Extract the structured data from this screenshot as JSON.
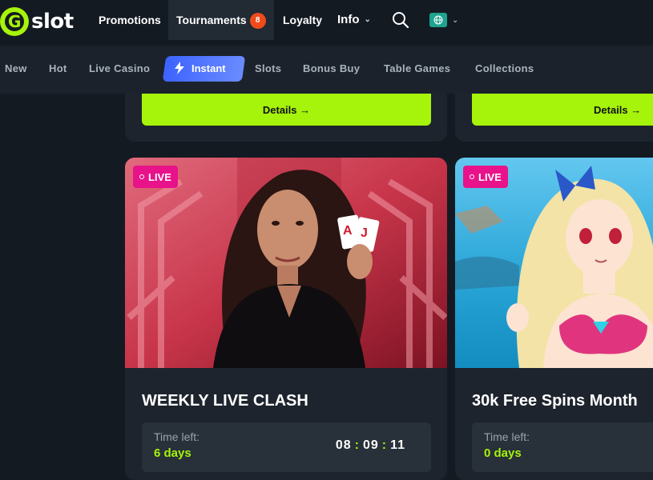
{
  "brand": {
    "logo_letter": "G",
    "logo_text": "slot"
  },
  "header": {
    "nav": [
      {
        "label": "Promotions"
      },
      {
        "label": "Tournaments",
        "badge": "8"
      },
      {
        "label": "Loyalty"
      },
      {
        "label": "Info"
      }
    ],
    "icons": {
      "search": "search-icon",
      "language": "globe-icon",
      "dropdown": "chevron-down-icon"
    }
  },
  "categories": [
    {
      "label": "New"
    },
    {
      "label": "Hot"
    },
    {
      "label": "Live Casino"
    },
    {
      "label": "Instant",
      "active": true,
      "icon": "lightning-icon"
    },
    {
      "label": "Slots"
    },
    {
      "label": "Bonus Buy"
    },
    {
      "label": "Table Games"
    },
    {
      "label": "Collections"
    }
  ],
  "top_cards": [
    {
      "button": "Details →"
    },
    {
      "button": "Details →"
    }
  ],
  "promos": [
    {
      "badge": "LIVE",
      "title": "WEEKLY LIVE CLASH",
      "time_label": "Time left:",
      "time_value": "6 days",
      "timer": {
        "h": "08",
        "m": "09",
        "s": "11"
      }
    },
    {
      "badge": "LIVE",
      "title": "30k Free Spins Month",
      "time_label": "Time left:",
      "time_value": "0 days"
    }
  ],
  "colors": {
    "accent": "#a6f30b",
    "live": "#e8128a",
    "badge": "#ef4b1b",
    "instant": "#4a6dff",
    "bg": "#141a22"
  }
}
